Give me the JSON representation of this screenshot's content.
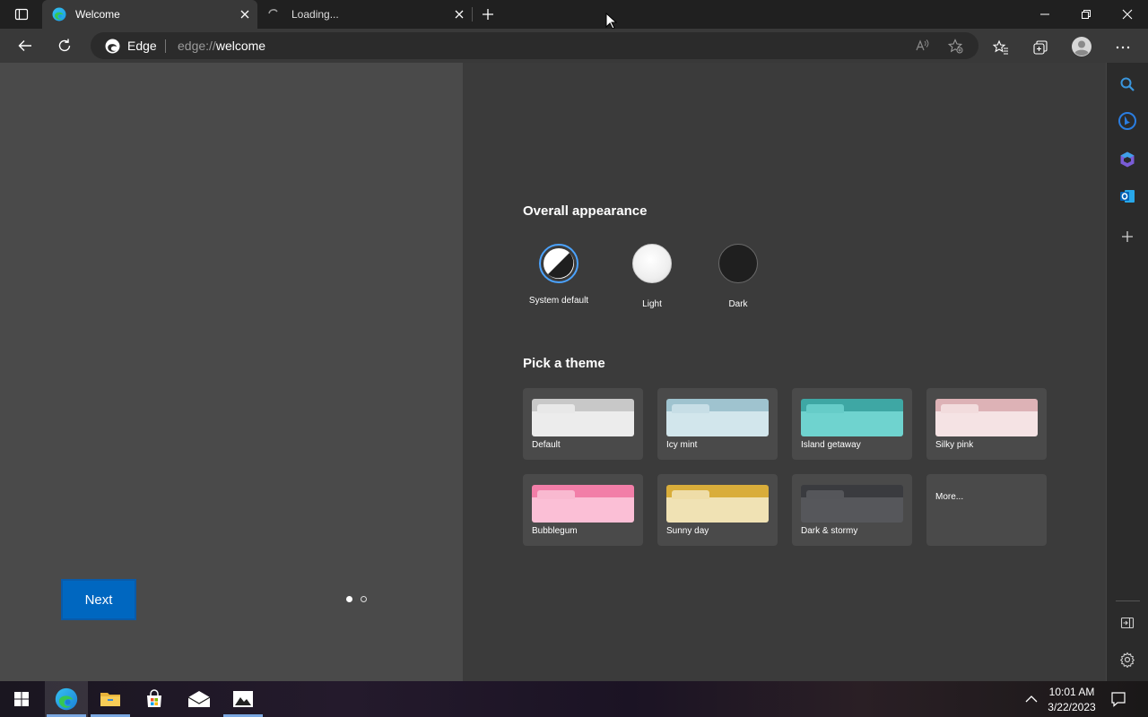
{
  "tabs": [
    {
      "title": "Welcome",
      "active": true
    },
    {
      "title": "Loading...",
      "active": false
    }
  ],
  "address": {
    "site_label": "Edge",
    "url_prefix": "edge://",
    "url_host": "welcome"
  },
  "appearance": {
    "title": "Overall appearance",
    "options": [
      {
        "label": "System default",
        "selected": true
      },
      {
        "label": "Light",
        "selected": false
      },
      {
        "label": "Dark",
        "selected": false
      }
    ]
  },
  "themes": {
    "title": "Pick a theme",
    "items": [
      {
        "name": "Default",
        "top": "#c8c8c8",
        "tab": "#e8e8e8",
        "body": "#ececec"
      },
      {
        "name": "Icy mint",
        "top": "#9fc3cf",
        "tab": "#c7dee6",
        "body": "#d2e6ec"
      },
      {
        "name": "Island getaway",
        "top": "#3ea7a4",
        "tab": "#66ccc8",
        "body": "#6fd3cf"
      },
      {
        "name": "Silky pink",
        "top": "#ddb2b6",
        "tab": "#f2dcdd",
        "body": "#f5e3e4"
      },
      {
        "name": "Bubblegum",
        "top": "#f27ea8",
        "tab": "#f9b9d0",
        "body": "#fbbfd6"
      },
      {
        "name": "Sunny day",
        "top": "#d9ad3a",
        "tab": "#efdda8",
        "body": "#f0e2b4"
      },
      {
        "name": "Dark & stormy",
        "top": "#3a3b3f",
        "tab": "#55565a",
        "body": "#56575b"
      },
      {
        "name": "More...",
        "more": true
      }
    ]
  },
  "next_button": "Next",
  "pagination": {
    "current": 1,
    "total": 2
  },
  "clock": {
    "time": "10:01 AM",
    "date": "3/22/2023"
  },
  "colors": {
    "accent": "#0067c0",
    "panel_left": "#4a4a4a",
    "panel_right": "#3b3b3b"
  }
}
